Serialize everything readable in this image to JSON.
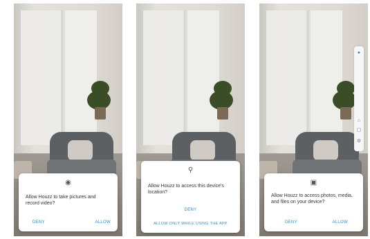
{
  "screens": [
    {
      "dialog": {
        "icon": "camera-icon",
        "message": "Allow Houzz to take pictures and record video?",
        "deny": "DENY",
        "allow": "ALLOW"
      }
    },
    {
      "dialog": {
        "icon": "location-pin-icon",
        "message": "Allow Houzz to access this device's location?",
        "deny": "DENY",
        "allow": "ALLOW ONLY WHILE USING THE APP"
      }
    },
    {
      "dialog": {
        "icon": "photo-media-icon",
        "message": "Allow Houzz to access photos, media, and files on your device?",
        "deny": "DENY",
        "allow": "ALLOW"
      },
      "sidebar_icons": [
        "info-icon",
        "home-icon",
        "share-icon",
        "settings-icon"
      ]
    }
  ],
  "colors": {
    "accent": "#2a8bd0"
  }
}
